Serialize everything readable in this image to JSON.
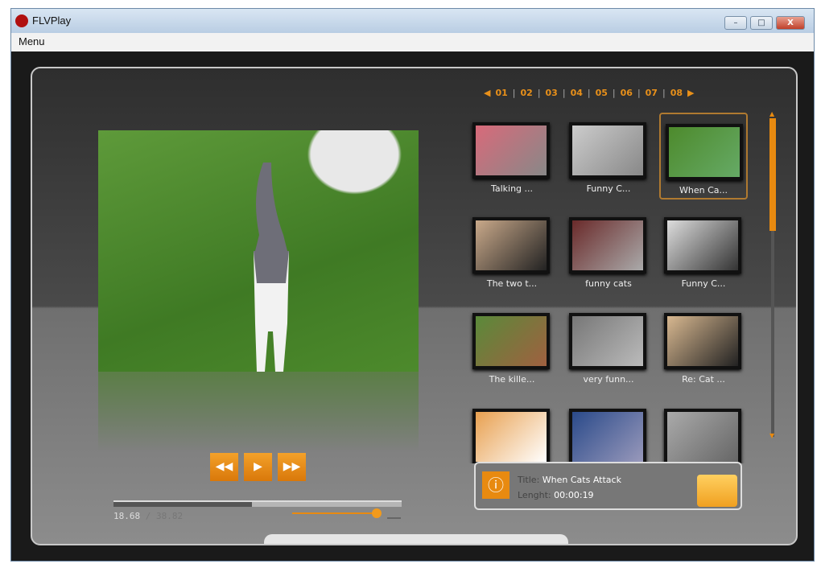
{
  "window": {
    "title": "FLVPlay",
    "menu": "Menu",
    "minimize": "–",
    "maximize": "□",
    "close": "X"
  },
  "player": {
    "rewind": "◀◀",
    "play": "▶",
    "forward": "▶▶",
    "current_time": "18.68",
    "total_time": "38.82",
    "time_sep": " / ",
    "progress_fraction": 0.48,
    "volume_fraction": 1.0
  },
  "pager": {
    "prev": "◀",
    "next": "▶",
    "pages": [
      "01",
      "02",
      "03",
      "04",
      "05",
      "06",
      "07",
      "08"
    ]
  },
  "playlist": [
    {
      "label": "Talking ...",
      "colors": [
        "#d86a7a",
        "#888"
      ]
    },
    {
      "label": "Funny C...",
      "colors": [
        "#ccc",
        "#888"
      ]
    },
    {
      "label": "When Ca...",
      "colors": [
        "#4d8a2c",
        "#6a6"
      ],
      "selected": true
    },
    {
      "label": "The two t...",
      "colors": [
        "#c9a98a",
        "#222"
      ]
    },
    {
      "label": "funny cats",
      "colors": [
        "#6a2a2a",
        "#aaa"
      ]
    },
    {
      "label": "Funny C...",
      "colors": [
        "#ddd",
        "#333"
      ]
    },
    {
      "label": "The kille...",
      "colors": [
        "#5a8a3a",
        "#a06040"
      ]
    },
    {
      "label": "very funn...",
      "colors": [
        "#777",
        "#bbb"
      ]
    },
    {
      "label": "Re: Cat ...",
      "colors": [
        "#d8b890",
        "#222"
      ]
    },
    {
      "label": "",
      "colors": [
        "#e8a050",
        "#fff"
      ]
    },
    {
      "label": "",
      "colors": [
        "#2a4a8a",
        "#99b"
      ]
    },
    {
      "label": "",
      "colors": [
        "#aaa",
        "#666"
      ]
    }
  ],
  "info": {
    "title_key": "Title:",
    "title_value": "When Cats Attack",
    "length_key": "Lenght:",
    "length_value": "00:00:19",
    "icon": "info-icon"
  },
  "colors": {
    "accent": "#e88a10"
  }
}
